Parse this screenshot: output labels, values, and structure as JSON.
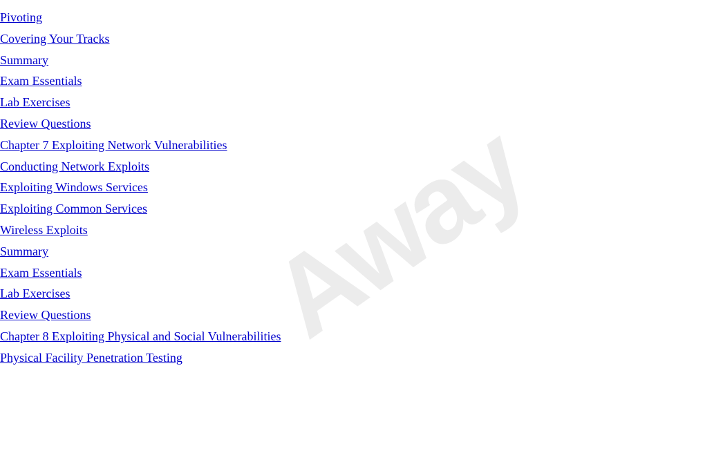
{
  "watermark": {
    "text": "Away"
  },
  "toc": {
    "items": [
      {
        "id": "pivoting",
        "label": "Pivoting",
        "indent": "indent-2",
        "type": "section"
      },
      {
        "id": "covering-your-tracks",
        "label": "Covering Your Tracks",
        "indent": "indent-2",
        "type": "section"
      },
      {
        "id": "summary-1",
        "label": "Summary",
        "indent": "indent-2",
        "type": "section"
      },
      {
        "id": "exam-essentials-1",
        "label": "Exam Essentials",
        "indent": "indent-2",
        "type": "section"
      },
      {
        "id": "lab-exercises-1",
        "label": "Lab Exercises",
        "indent": "indent-2",
        "type": "section"
      },
      {
        "id": "review-questions-1",
        "label": "Review Questions",
        "indent": "indent-2",
        "type": "section"
      },
      {
        "id": "chapter-7",
        "label": "Chapter 7 Exploiting Network Vulnerabilities",
        "indent": "chapter-item",
        "type": "chapter"
      },
      {
        "id": "conducting-network-exploits",
        "label": "Conducting Network Exploits",
        "indent": "indent-2",
        "type": "section"
      },
      {
        "id": "exploiting-windows-services",
        "label": "Exploiting Windows Services",
        "indent": "indent-2",
        "type": "section"
      },
      {
        "id": "exploiting-common-services",
        "label": "Exploiting Common Services",
        "indent": "indent-2",
        "type": "section"
      },
      {
        "id": "wireless-exploits",
        "label": "Wireless Exploits",
        "indent": "indent-2",
        "type": "section"
      },
      {
        "id": "summary-2",
        "label": "Summary",
        "indent": "indent-2",
        "type": "section"
      },
      {
        "id": "exam-essentials-2",
        "label": "Exam Essentials",
        "indent": "indent-2",
        "type": "section"
      },
      {
        "id": "lab-exercises-2",
        "label": "Lab Exercises",
        "indent": "indent-2",
        "type": "section"
      },
      {
        "id": "review-questions-2",
        "label": "Review Questions",
        "indent": "indent-2",
        "type": "section"
      },
      {
        "id": "chapter-8",
        "label": "Chapter 8 Exploiting Physical and Social Vulnerabilities",
        "indent": "chapter-item",
        "type": "chapter"
      },
      {
        "id": "physical-facility-penetration",
        "label": "Physical Facility Penetration Testing",
        "indent": "indent-2",
        "type": "section"
      }
    ]
  }
}
